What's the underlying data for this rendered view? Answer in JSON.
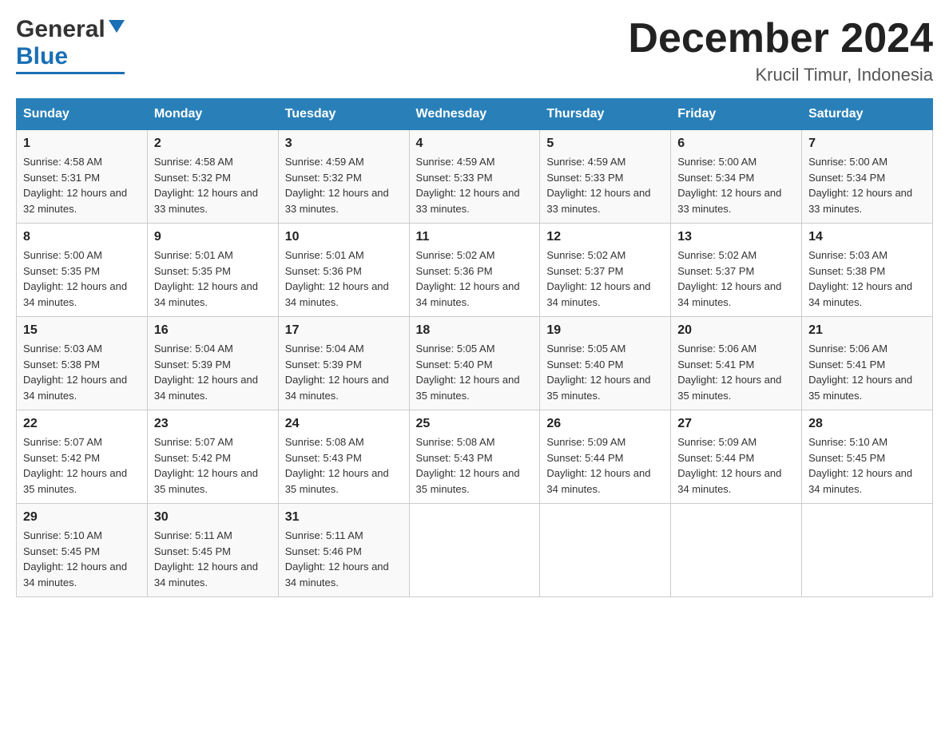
{
  "header": {
    "logo_general": "General",
    "logo_blue": "Blue",
    "month_title": "December 2024",
    "location": "Krucil Timur, Indonesia"
  },
  "days_of_week": [
    "Sunday",
    "Monday",
    "Tuesday",
    "Wednesday",
    "Thursday",
    "Friday",
    "Saturday"
  ],
  "weeks": [
    [
      {
        "day": "1",
        "sunrise": "4:58 AM",
        "sunset": "5:31 PM",
        "daylight": "12 hours and 32 minutes."
      },
      {
        "day": "2",
        "sunrise": "4:58 AM",
        "sunset": "5:32 PM",
        "daylight": "12 hours and 33 minutes."
      },
      {
        "day": "3",
        "sunrise": "4:59 AM",
        "sunset": "5:32 PM",
        "daylight": "12 hours and 33 minutes."
      },
      {
        "day": "4",
        "sunrise": "4:59 AM",
        "sunset": "5:33 PM",
        "daylight": "12 hours and 33 minutes."
      },
      {
        "day": "5",
        "sunrise": "4:59 AM",
        "sunset": "5:33 PM",
        "daylight": "12 hours and 33 minutes."
      },
      {
        "day": "6",
        "sunrise": "5:00 AM",
        "sunset": "5:34 PM",
        "daylight": "12 hours and 33 minutes."
      },
      {
        "day": "7",
        "sunrise": "5:00 AM",
        "sunset": "5:34 PM",
        "daylight": "12 hours and 33 minutes."
      }
    ],
    [
      {
        "day": "8",
        "sunrise": "5:00 AM",
        "sunset": "5:35 PM",
        "daylight": "12 hours and 34 minutes."
      },
      {
        "day": "9",
        "sunrise": "5:01 AM",
        "sunset": "5:35 PM",
        "daylight": "12 hours and 34 minutes."
      },
      {
        "day": "10",
        "sunrise": "5:01 AM",
        "sunset": "5:36 PM",
        "daylight": "12 hours and 34 minutes."
      },
      {
        "day": "11",
        "sunrise": "5:02 AM",
        "sunset": "5:36 PM",
        "daylight": "12 hours and 34 minutes."
      },
      {
        "day": "12",
        "sunrise": "5:02 AM",
        "sunset": "5:37 PM",
        "daylight": "12 hours and 34 minutes."
      },
      {
        "day": "13",
        "sunrise": "5:02 AM",
        "sunset": "5:37 PM",
        "daylight": "12 hours and 34 minutes."
      },
      {
        "day": "14",
        "sunrise": "5:03 AM",
        "sunset": "5:38 PM",
        "daylight": "12 hours and 34 minutes."
      }
    ],
    [
      {
        "day": "15",
        "sunrise": "5:03 AM",
        "sunset": "5:38 PM",
        "daylight": "12 hours and 34 minutes."
      },
      {
        "day": "16",
        "sunrise": "5:04 AM",
        "sunset": "5:39 PM",
        "daylight": "12 hours and 34 minutes."
      },
      {
        "day": "17",
        "sunrise": "5:04 AM",
        "sunset": "5:39 PM",
        "daylight": "12 hours and 34 minutes."
      },
      {
        "day": "18",
        "sunrise": "5:05 AM",
        "sunset": "5:40 PM",
        "daylight": "12 hours and 35 minutes."
      },
      {
        "day": "19",
        "sunrise": "5:05 AM",
        "sunset": "5:40 PM",
        "daylight": "12 hours and 35 minutes."
      },
      {
        "day": "20",
        "sunrise": "5:06 AM",
        "sunset": "5:41 PM",
        "daylight": "12 hours and 35 minutes."
      },
      {
        "day": "21",
        "sunrise": "5:06 AM",
        "sunset": "5:41 PM",
        "daylight": "12 hours and 35 minutes."
      }
    ],
    [
      {
        "day": "22",
        "sunrise": "5:07 AM",
        "sunset": "5:42 PM",
        "daylight": "12 hours and 35 minutes."
      },
      {
        "day": "23",
        "sunrise": "5:07 AM",
        "sunset": "5:42 PM",
        "daylight": "12 hours and 35 minutes."
      },
      {
        "day": "24",
        "sunrise": "5:08 AM",
        "sunset": "5:43 PM",
        "daylight": "12 hours and 35 minutes."
      },
      {
        "day": "25",
        "sunrise": "5:08 AM",
        "sunset": "5:43 PM",
        "daylight": "12 hours and 35 minutes."
      },
      {
        "day": "26",
        "sunrise": "5:09 AM",
        "sunset": "5:44 PM",
        "daylight": "12 hours and 34 minutes."
      },
      {
        "day": "27",
        "sunrise": "5:09 AM",
        "sunset": "5:44 PM",
        "daylight": "12 hours and 34 minutes."
      },
      {
        "day": "28",
        "sunrise": "5:10 AM",
        "sunset": "5:45 PM",
        "daylight": "12 hours and 34 minutes."
      }
    ],
    [
      {
        "day": "29",
        "sunrise": "5:10 AM",
        "sunset": "5:45 PM",
        "daylight": "12 hours and 34 minutes."
      },
      {
        "day": "30",
        "sunrise": "5:11 AM",
        "sunset": "5:45 PM",
        "daylight": "12 hours and 34 minutes."
      },
      {
        "day": "31",
        "sunrise": "5:11 AM",
        "sunset": "5:46 PM",
        "daylight": "12 hours and 34 minutes."
      },
      null,
      null,
      null,
      null
    ]
  ]
}
